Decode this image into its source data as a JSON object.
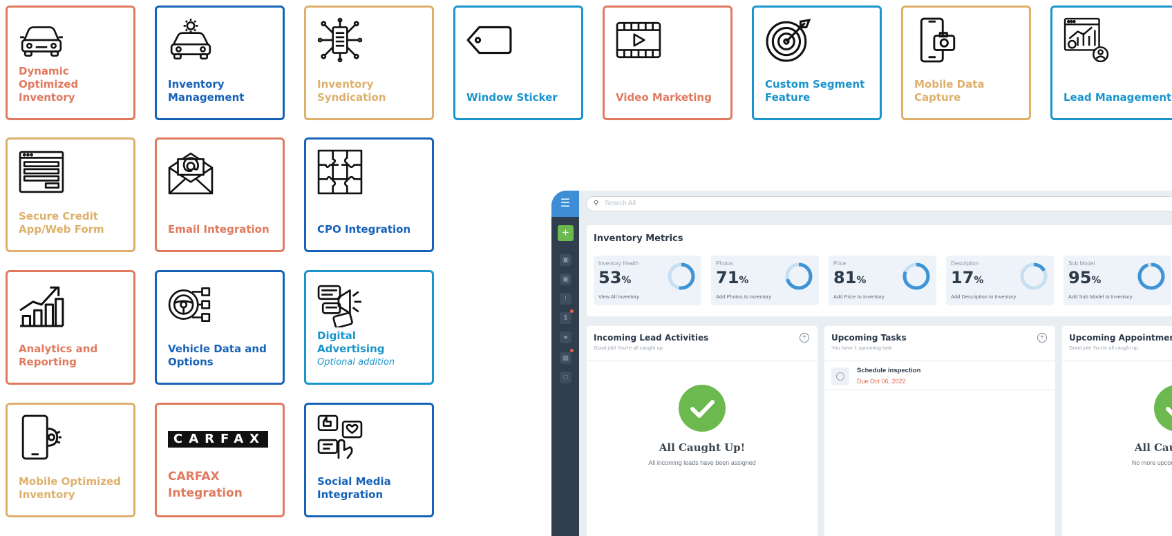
{
  "colors": {
    "orange": "#e07a5f",
    "blue": "#1662b7",
    "gold": "#ddb06b",
    "cyan": "#1a94cc",
    "green": "#6cb94f",
    "sidebar": "#2f3d4c"
  },
  "cards": [
    {
      "icon": "car-icon",
      "label": "Dynamic Optimized Inventory"
    },
    {
      "icon": "car-gear-icon",
      "label": "Inventory Management"
    },
    {
      "icon": "network-syndication-icon",
      "label": "Inventory Syndication"
    },
    {
      "icon": "tag-icon",
      "label": "Window Sticker"
    },
    {
      "icon": "video-film-icon",
      "label": "Video Marketing"
    },
    {
      "icon": "target-icon",
      "label": "Custom Segment Feature"
    },
    {
      "icon": "phone-camera-icon",
      "label": "Mobile Data Capture"
    },
    {
      "icon": "lead-chart-icon",
      "label": "Lead Management"
    },
    {
      "icon": "web-form-icon",
      "label": "Secure Credit App/Web Form"
    },
    {
      "icon": "email-envelope-icon",
      "label": "Email Integration"
    },
    {
      "icon": "puzzle-icon",
      "label": "CPO Integration"
    },
    {
      "icon": "bar-chart-icon",
      "label": "Analytics and Reporting"
    },
    {
      "icon": "steering-wheel-icon",
      "label": "Vehicle Data and Options"
    },
    {
      "icon": "megaphone-icon",
      "label": "Digital Advertising",
      "sublabel": "Optional addition"
    },
    {
      "icon": "phone-gear-icon",
      "label": "Mobile Optimized Inventory"
    },
    {
      "icon": "carfax-logo",
      "logo_text": "CARFAX",
      "label": "CARFAX Integration"
    },
    {
      "icon": "social-media-icon",
      "label": "Social Media Integration"
    }
  ],
  "dashboard": {
    "search_placeholder": "Search All",
    "sidebar_icons": [
      "add-icon",
      "car-icon",
      "car-front-icon",
      "alert-icon",
      "dollar-icon",
      "chat-icon",
      "calendar-icon",
      "clipboard-icon"
    ],
    "metrics": {
      "title": "Inventory Metrics",
      "items": [
        {
          "label": "Inventory Health",
          "value": "53",
          "unit": "%",
          "action": "View All Inventory",
          "percent": 53
        },
        {
          "label": "Photos",
          "value": "71",
          "unit": "%",
          "action": "Add Photos to Inventory",
          "percent": 71
        },
        {
          "label": "Price",
          "value": "81",
          "unit": "%",
          "action": "Add Price to Inventory",
          "percent": 81
        },
        {
          "label": "Description",
          "value": "17",
          "unit": "%",
          "action": "Add Description to Inventory",
          "percent": 17
        },
        {
          "label": "Sub Model",
          "value": "95",
          "unit": "%",
          "action": "Add Sub Model to Inventory",
          "percent": 95
        }
      ]
    },
    "leads": {
      "title": "Incoming Lead Activities",
      "subtitle": "Good job! You're all caught up.",
      "empty_title": "All Caught Up!",
      "empty_text": "All incoming leads have been assigned"
    },
    "tasks": {
      "title": "Upcoming Tasks",
      "subtitle": "You have 1 upcoming task",
      "item_title": "Schedule inspection",
      "item_due": "Due Oct 06, 2022"
    },
    "appointments": {
      "title": "Upcoming Appointments",
      "subtitle": "Good job! You're all caught up.",
      "empty_title": "All Caught Up!",
      "empty_text": "No more upcoming appointments"
    }
  }
}
